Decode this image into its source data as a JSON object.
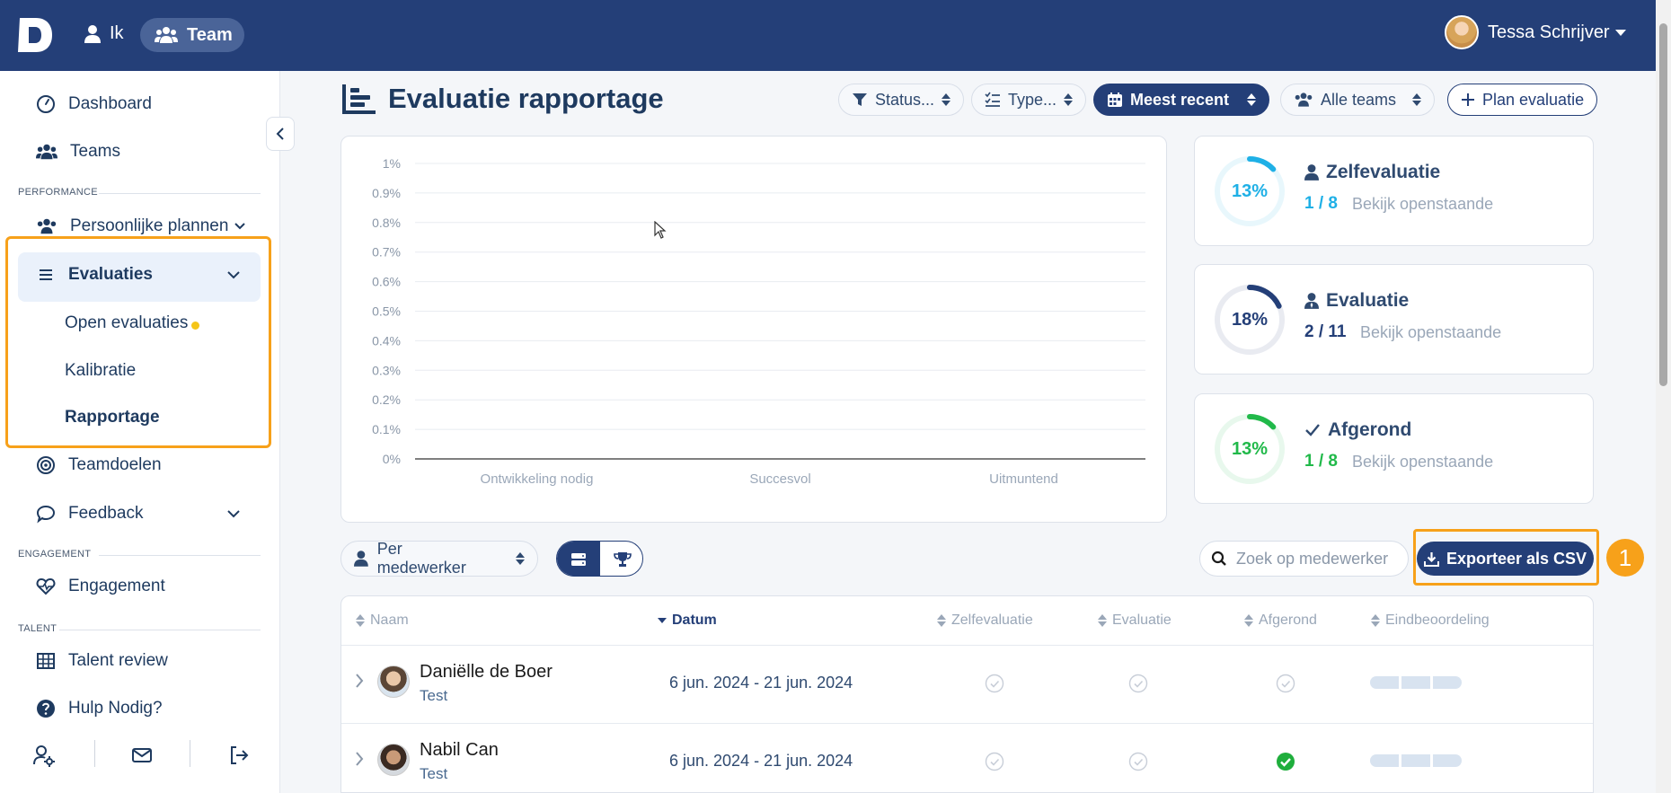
{
  "topbar": {
    "nav_ik": "Ik",
    "nav_team": "Team",
    "user_name": "Tessa Schrijver"
  },
  "sidebar": {
    "dashboard": "Dashboard",
    "teams": "Teams",
    "section_performance": "PERFORMANCE",
    "persoonlijke_plannen": "Persoonlijke plannen",
    "evaluaties": "Evaluaties",
    "open_evaluaties": "Open evaluaties",
    "kalibratie": "Kalibratie",
    "rapportage": "Rapportage",
    "teamdoelen": "Teamdoelen",
    "feedback": "Feedback",
    "section_engagement": "ENGAGEMENT",
    "engagement": "Engagement",
    "section_talent": "TALENT",
    "talent_review": "Talent review",
    "hulp": "Hulp Nodig?"
  },
  "header": {
    "title": "Evaluatie rapportage",
    "filter_status": "Status...",
    "filter_type": "Type...",
    "sort": "Meest recent",
    "teams": "Alle teams",
    "plan": "Plan evaluatie"
  },
  "chart_data": {
    "type": "bar",
    "categories": [
      "Ontwikkeling nodig",
      "Succesvol",
      "Uitmuntend"
    ],
    "values": [
      0,
      0,
      0
    ],
    "ylim": [
      0,
      1
    ],
    "yticks": [
      "0%",
      "0.1%",
      "0.2%",
      "0.3%",
      "0.4%",
      "0.5%",
      "0.6%",
      "0.7%",
      "0.8%",
      "0.9%",
      "1%"
    ],
    "grid": true
  },
  "stats": [
    {
      "pct": "13%",
      "pct_value": 0.13,
      "title": "Zelfevaluatie",
      "count": "1 / 8",
      "link": "Bekijk openstaande",
      "color": "#1fb0e6"
    },
    {
      "pct": "18%",
      "pct_value": 0.18,
      "title": "Evaluatie",
      "count": "2 / 11",
      "link": "Bekijk openstaande",
      "color": "#243f78"
    },
    {
      "pct": "13%",
      "pct_value": 0.13,
      "title": "Afgerond",
      "count": "1 / 8",
      "link": "Bekijk openstaande",
      "color": "#21b94a"
    }
  ],
  "toolbar": {
    "per_medewerker": "Per medewerker",
    "search_placeholder": "Zoek op medewerker",
    "export": "Exporteer als CSV",
    "step_badge": "1"
  },
  "table": {
    "columns": [
      "Naam",
      "Datum",
      "Zelfevaluatie",
      "Evaluatie",
      "Afgerond",
      "Eindbeoordeling"
    ],
    "rows": [
      {
        "name": "Daniëlle de Boer",
        "sub": "Test",
        "date": "6 jun. 2024 - 21 jun. 2024",
        "zelf": false,
        "eval": false,
        "afgerond": false
      },
      {
        "name": "Nabil Can",
        "sub": "Test",
        "date": "6 jun. 2024 - 21 jun. 2024",
        "zelf": false,
        "eval": false,
        "afgerond": true
      }
    ]
  }
}
